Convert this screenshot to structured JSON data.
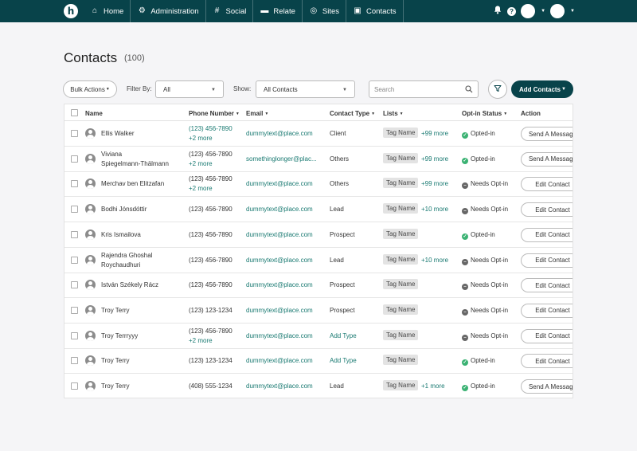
{
  "nav": {
    "logo": "h",
    "items": [
      {
        "label": "Home",
        "icon": "home-icon",
        "glyph": "⌂"
      },
      {
        "label": "Administration",
        "icon": "gear-icon",
        "glyph": "⚙"
      },
      {
        "label": "Social",
        "icon": "hashtag-icon",
        "glyph": "#"
      },
      {
        "label": "Relate",
        "icon": "chat-icon",
        "glyph": "▬"
      },
      {
        "label": "Sites",
        "icon": "globe-icon",
        "glyph": "◎"
      },
      {
        "label": "Contacts",
        "icon": "contact-card-icon",
        "glyph": "▣"
      }
    ],
    "bell_glyph": "🔔",
    "help_glyph": "?"
  },
  "page": {
    "title": "Contacts",
    "count": "(100)"
  },
  "toolbar": {
    "bulk_actions": "Bulk Actions",
    "filter_by_label": "Filter By:",
    "filter_by_value": "All",
    "show_label": "Show:",
    "show_value": "All Contacts",
    "search_placeholder": "Search",
    "add_contacts": "Add Contacts"
  },
  "table": {
    "headers": {
      "name": "Name",
      "phone": "Phone Number",
      "email": "Email",
      "contact_type": "Contact Type",
      "lists": "Lists",
      "optin": "Opt-in Status",
      "action": "Action"
    },
    "rows": [
      {
        "name": "Ellis Walker",
        "name2": "",
        "phone": "(123) 456-7890",
        "phone_more": "+2 more",
        "phone_link": true,
        "email": "dummytext@place.com",
        "type": "Client",
        "type_link": false,
        "tag": "Tag Name",
        "tag_more": "+99 more",
        "status": "Opted-in",
        "status_kind": "ok",
        "action": "Send A Message"
      },
      {
        "name": "Viviana",
        "name2": "Spiegelmann-Thälmann",
        "phone": "(123) 456-7890",
        "phone_more": "+2 more",
        "phone_link": false,
        "email": "somethinglonger@plac...",
        "type": "Others",
        "type_link": false,
        "tag": "Tag Name",
        "tag_more": "+99 more",
        "status": "Opted-in",
        "status_kind": "ok",
        "action": "Send A Message"
      },
      {
        "name": "Merchav ben Elitzafan",
        "name2": "",
        "phone": "(123) 456-7890",
        "phone_more": "+2 more",
        "phone_link": false,
        "email": "dummytext@place.com",
        "type": "Others",
        "type_link": false,
        "tag": "Tag Name",
        "tag_more": "+99 more",
        "status": "Needs Opt-in",
        "status_kind": "need",
        "action": "Edit Contact"
      },
      {
        "name": "Bodhi Jónsdóttir",
        "name2": "",
        "phone": "(123) 456-7890",
        "phone_more": "",
        "phone_link": false,
        "email": "dummytext@place.com",
        "type": "Lead",
        "type_link": false,
        "tag": "Tag Name",
        "tag_more": "+10 more",
        "status": "Needs Opt-in",
        "status_kind": "need",
        "action": "Edit Contact"
      },
      {
        "name": "Kris Ismailova",
        "name2": "",
        "phone": "(123) 456-7890",
        "phone_more": "",
        "phone_link": false,
        "email": "dummytext@place.com",
        "type": "Prospect",
        "type_link": false,
        "tag": "Tag Name",
        "tag_more": "",
        "status": "Opted-in",
        "status_kind": "ok",
        "action": "Edit Contact"
      },
      {
        "name": "Rajendra Ghoshal",
        "name2": "Roychaudhuri",
        "phone": "(123) 456-7890",
        "phone_more": "",
        "phone_link": false,
        "email": "dummytext@place.com",
        "type": "Lead",
        "type_link": false,
        "tag": "Tag Name",
        "tag_more": "+10 more",
        "status": "Needs Opt-in",
        "status_kind": "need",
        "action": "Edit Contact"
      },
      {
        "name": "István Székely Rácz",
        "name2": "",
        "phone": "(123) 456-7890",
        "phone_more": "",
        "phone_link": false,
        "email": "dummytext@place.com",
        "type": "Prospect",
        "type_link": false,
        "tag": "Tag Name",
        "tag_more": "",
        "status": "Needs Opt-in",
        "status_kind": "need",
        "action": "Edit Contact"
      },
      {
        "name": "Troy Terry",
        "name2": "",
        "phone": "(123) 123-1234",
        "phone_more": "",
        "phone_link": false,
        "email": "dummytext@place.com",
        "type": "Prospect",
        "type_link": false,
        "tag": "Tag Name",
        "tag_more": "",
        "status": "Needs Opt-in",
        "status_kind": "need",
        "action": "Edit Contact"
      },
      {
        "name": "Troy Terrryyy",
        "name2": "",
        "phone": "(123) 456-7890",
        "phone_more": "+2 more",
        "phone_link": false,
        "email": "dummytext@place.com",
        "type": "Add Type",
        "type_link": true,
        "tag": "Tag Name",
        "tag_more": "",
        "status": "Needs Opt-in",
        "status_kind": "need",
        "action": "Edit Contact"
      },
      {
        "name": "Troy Terry",
        "name2": "",
        "phone": "(123) 123-1234",
        "phone_more": "",
        "phone_link": false,
        "email": "dummytext@place.com",
        "type": "Add Type",
        "type_link": true,
        "tag": "Tag Name",
        "tag_more": "",
        "status": "Opted-in",
        "status_kind": "ok",
        "action": "Edit Contact"
      },
      {
        "name": "Troy Terry",
        "name2": "",
        "phone": "(408) 555-1234",
        "phone_more": "",
        "phone_link": false,
        "email": "dummytext@place.com",
        "type": "Lead",
        "type_link": false,
        "tag": "Tag Name",
        "tag_more": "+1  more",
        "status": "Opted-in",
        "status_kind": "ok",
        "action": "Send A Message"
      }
    ]
  },
  "colors": {
    "brand": "#08434a",
    "link": "#1a7a72",
    "opted_in": "#3bb273",
    "needs_optin": "#666666"
  }
}
